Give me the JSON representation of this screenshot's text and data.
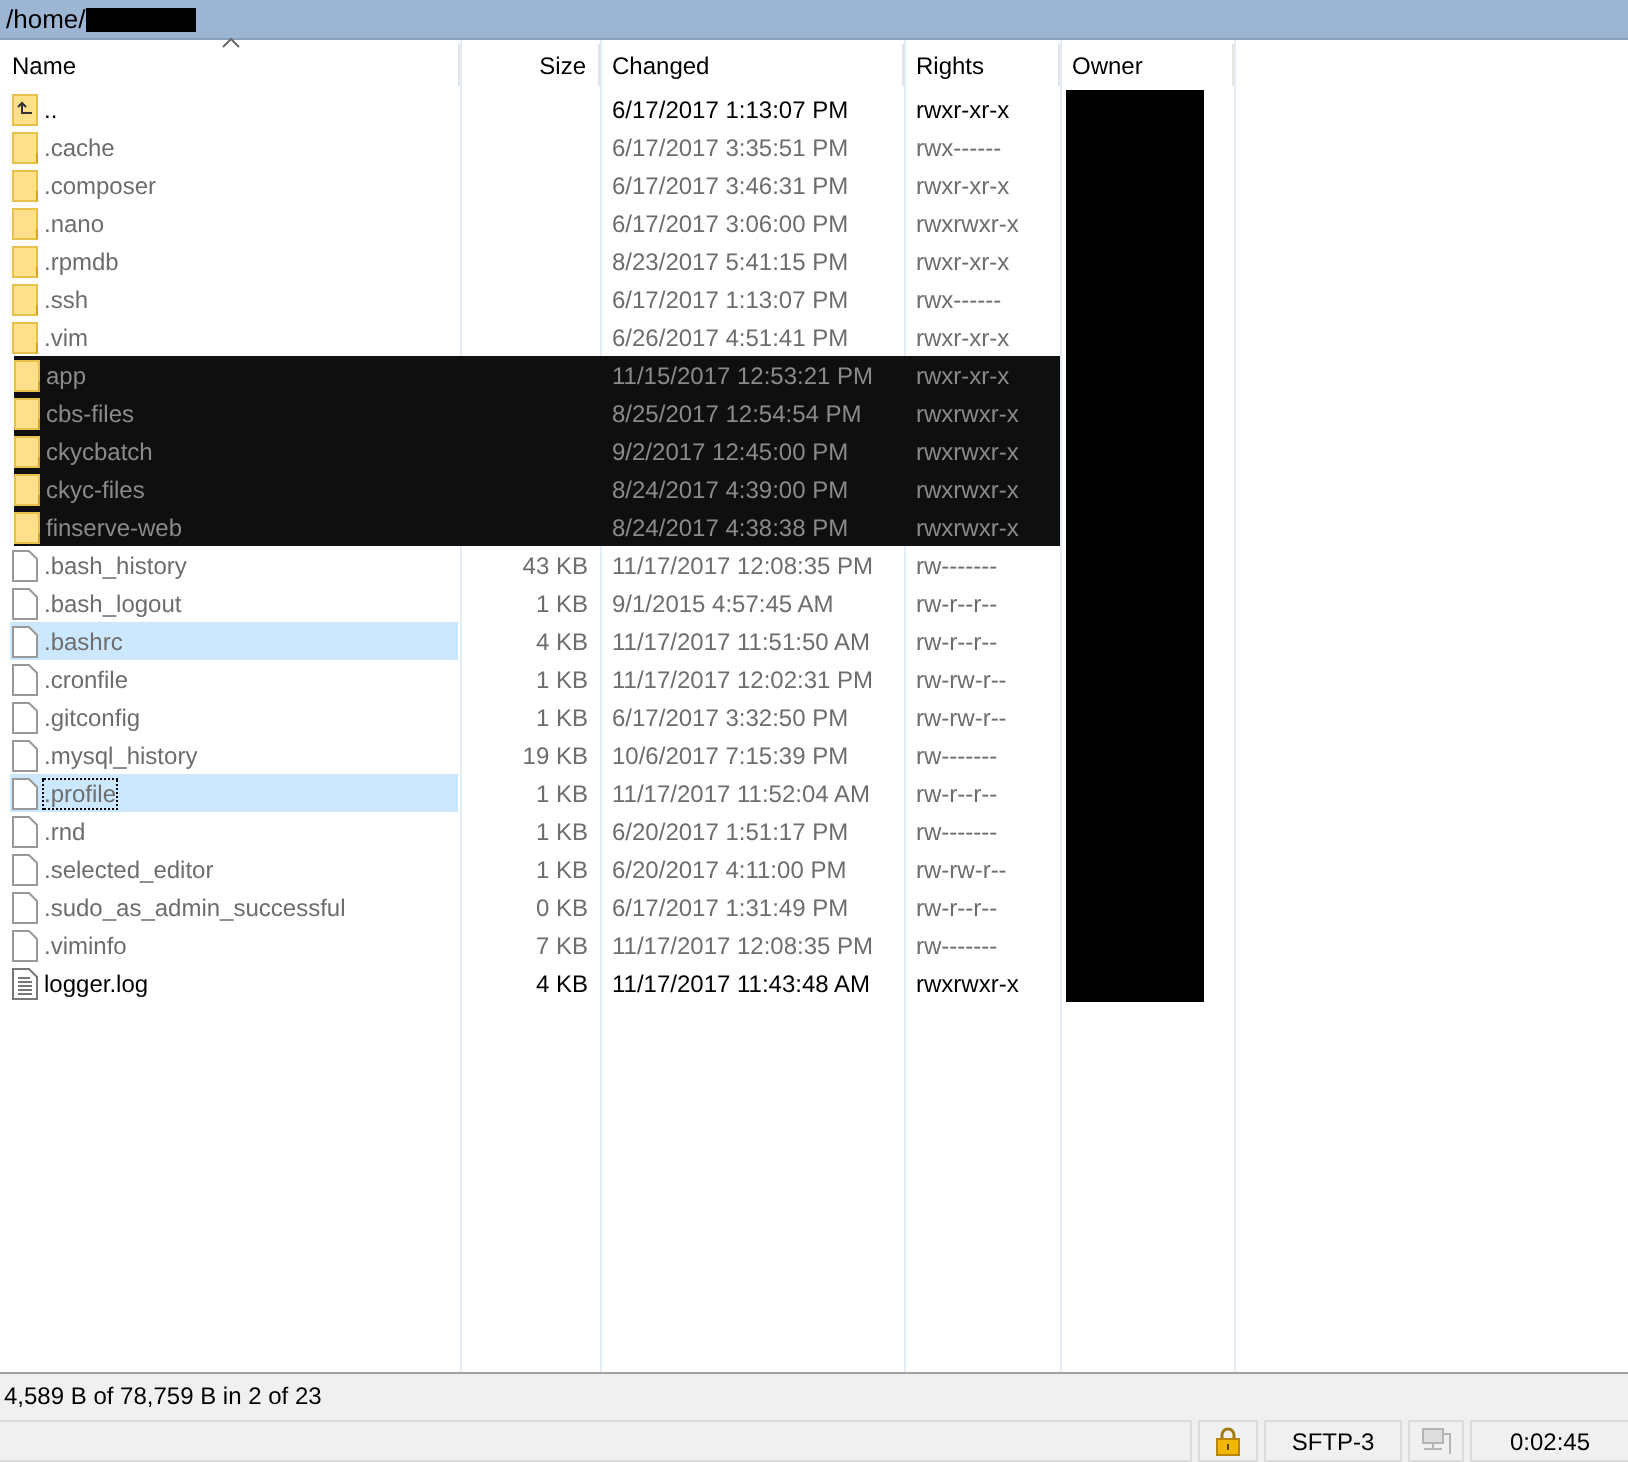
{
  "path": {
    "text": "/home/",
    "redacted": true
  },
  "table": {
    "columns": [
      {
        "label": "Name",
        "sorted": true
      },
      {
        "label": "Size",
        "sorted": false
      },
      {
        "label": "Changed",
        "sorted": false
      },
      {
        "label": "Rights",
        "sorted": false
      },
      {
        "label": "Owner",
        "sorted": false
      }
    ],
    "owner_redacted": true,
    "rows": [
      {
        "kind": "parent",
        "name": "..",
        "size": "",
        "changed": "6/17/2017 1:13:07 PM",
        "rights": "rwxr-xr-x",
        "hidden": false,
        "selected": false,
        "focused": false,
        "redacted": false
      },
      {
        "kind": "folder",
        "name": ".cache",
        "size": "",
        "changed": "6/17/2017 3:35:51 PM",
        "rights": "rwx------",
        "hidden": true,
        "selected": false,
        "focused": false,
        "redacted": false
      },
      {
        "kind": "folder",
        "name": ".composer",
        "size": "",
        "changed": "6/17/2017 3:46:31 PM",
        "rights": "rwxr-xr-x",
        "hidden": true,
        "selected": false,
        "focused": false,
        "redacted": false
      },
      {
        "kind": "folder",
        "name": ".nano",
        "size": "",
        "changed": "6/17/2017 3:06:00 PM",
        "rights": "rwxrwxr-x",
        "hidden": true,
        "selected": false,
        "focused": false,
        "redacted": false
      },
      {
        "kind": "folder",
        "name": ".rpmdb",
        "size": "",
        "changed": "8/23/2017 5:41:15 PM",
        "rights": "rwxr-xr-x",
        "hidden": true,
        "selected": false,
        "focused": false,
        "redacted": false
      },
      {
        "kind": "folder",
        "name": ".ssh",
        "size": "",
        "changed": "6/17/2017 1:13:07 PM",
        "rights": "rwx------",
        "hidden": true,
        "selected": false,
        "focused": false,
        "redacted": false
      },
      {
        "kind": "folder",
        "name": ".vim",
        "size": "",
        "changed": "6/26/2017 4:51:41 PM",
        "rights": "rwxr-xr-x",
        "hidden": true,
        "selected": false,
        "focused": false,
        "redacted": false
      },
      {
        "kind": "folder",
        "name": "app",
        "size": "",
        "changed": "11/15/2017 12:53:21 PM",
        "rights": "rwxr-xr-x",
        "hidden": false,
        "selected": false,
        "focused": false,
        "redacted": true
      },
      {
        "kind": "folder",
        "name": "cbs-files",
        "size": "",
        "changed": "8/25/2017 12:54:54 PM",
        "rights": "rwxrwxr-x",
        "hidden": false,
        "selected": false,
        "focused": false,
        "redacted": true
      },
      {
        "kind": "folder",
        "name": "ckycbatch",
        "size": "",
        "changed": "9/2/2017 12:45:00 PM",
        "rights": "rwxrwxr-x",
        "hidden": false,
        "selected": false,
        "focused": false,
        "redacted": true
      },
      {
        "kind": "folder",
        "name": "ckyc-files",
        "size": "",
        "changed": "8/24/2017 4:39:00 PM",
        "rights": "rwxrwxr-x",
        "hidden": false,
        "selected": false,
        "focused": false,
        "redacted": true
      },
      {
        "kind": "folder",
        "name": "finserve-web",
        "size": "",
        "changed": "8/24/2017 4:38:38 PM",
        "rights": "rwxrwxr-x",
        "hidden": false,
        "selected": false,
        "focused": false,
        "redacted": true
      },
      {
        "kind": "file",
        "name": ".bash_history",
        "size": "43 KB",
        "changed": "11/17/2017 12:08:35 PM",
        "rights": "rw-------",
        "hidden": true,
        "selected": false,
        "focused": false,
        "redacted": false
      },
      {
        "kind": "file",
        "name": ".bash_logout",
        "size": "1 KB",
        "changed": "9/1/2015 4:57:45 AM",
        "rights": "rw-r--r--",
        "hidden": true,
        "selected": false,
        "focused": false,
        "redacted": false
      },
      {
        "kind": "file",
        "name": ".bashrc",
        "size": "4 KB",
        "changed": "11/17/2017 11:51:50 AM",
        "rights": "rw-r--r--",
        "hidden": true,
        "selected": true,
        "focused": false,
        "redacted": false
      },
      {
        "kind": "file",
        "name": ".cronfile",
        "size": "1 KB",
        "changed": "11/17/2017 12:02:31 PM",
        "rights": "rw-rw-r--",
        "hidden": true,
        "selected": false,
        "focused": false,
        "redacted": false
      },
      {
        "kind": "file",
        "name": ".gitconfig",
        "size": "1 KB",
        "changed": "6/17/2017 3:32:50 PM",
        "rights": "rw-rw-r--",
        "hidden": true,
        "selected": false,
        "focused": false,
        "redacted": false
      },
      {
        "kind": "file",
        "name": ".mysql_history",
        "size": "19 KB",
        "changed": "10/6/2017 7:15:39 PM",
        "rights": "rw-------",
        "hidden": true,
        "selected": false,
        "focused": false,
        "redacted": false
      },
      {
        "kind": "file",
        "name": ".profile",
        "size": "1 KB",
        "changed": "11/17/2017 11:52:04 AM",
        "rights": "rw-r--r--",
        "hidden": true,
        "selected": true,
        "focused": true,
        "redacted": false
      },
      {
        "kind": "file",
        "name": ".rnd",
        "size": "1 KB",
        "changed": "6/20/2017 1:51:17 PM",
        "rights": "rw-------",
        "hidden": true,
        "selected": false,
        "focused": false,
        "redacted": false
      },
      {
        "kind": "file",
        "name": ".selected_editor",
        "size": "1 KB",
        "changed": "6/20/2017 4:11:00 PM",
        "rights": "rw-rw-r--",
        "hidden": true,
        "selected": false,
        "focused": false,
        "redacted": false
      },
      {
        "kind": "file",
        "name": ".sudo_as_admin_successful",
        "size": "0 KB",
        "changed": "6/17/2017 1:31:49 PM",
        "rights": "rw-r--r--",
        "hidden": true,
        "selected": false,
        "focused": false,
        "redacted": false
      },
      {
        "kind": "file",
        "name": ".viminfo",
        "size": "7 KB",
        "changed": "11/17/2017 12:08:35 PM",
        "rights": "rw-------",
        "hidden": true,
        "selected": false,
        "focused": false,
        "redacted": false
      },
      {
        "kind": "text-file",
        "name": "logger.log",
        "size": "4 KB",
        "changed": "11/17/2017 11:43:48 AM",
        "rights": "rwxrwxr-x",
        "hidden": false,
        "selected": false,
        "focused": false,
        "redacted": false
      }
    ]
  },
  "selection_status": "4,589 B of 78,759 B in 2 of 23",
  "status_bar": {
    "encrypted": true,
    "protocol": "SFTP-3",
    "connected": false,
    "elapsed": "0:02:45"
  }
}
